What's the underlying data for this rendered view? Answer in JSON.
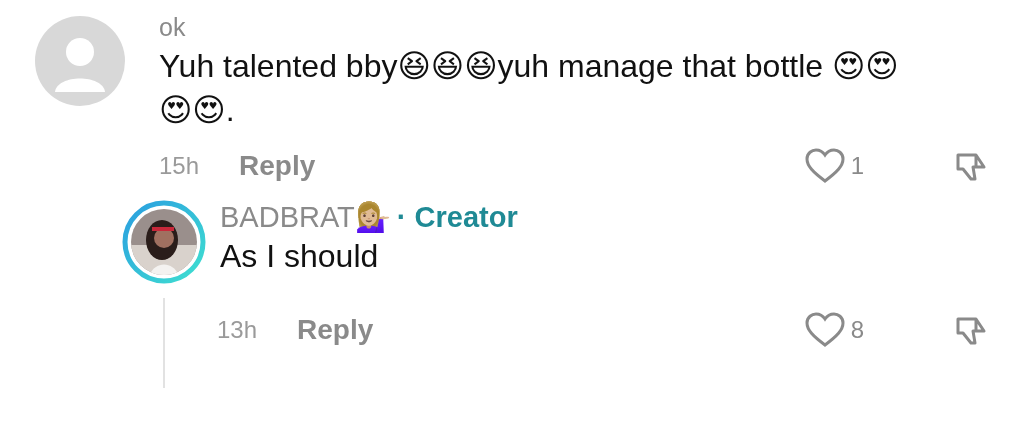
{
  "comments": [
    {
      "author": "ok",
      "text": "Yuh talented bby😆😆😆yuh manage that bottle 😍😍😍😍.",
      "time": "15h",
      "reply_label": "Reply",
      "likes": "1",
      "liked": false,
      "replies": [
        {
          "author": "BADBRAT💁🏼‍♀️",
          "badge": "· Creator",
          "text": "As I should",
          "time": "13h",
          "reply_label": "Reply",
          "likes": "8",
          "liked": false
        }
      ]
    }
  ]
}
